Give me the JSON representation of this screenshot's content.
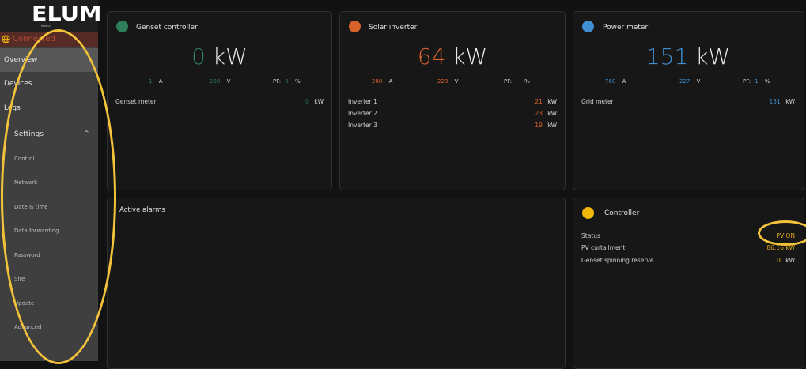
{
  "brand": {
    "logo": "ELUM",
    "tagline": "ENERGY"
  },
  "connection": {
    "label": "Connected"
  },
  "nav": {
    "overview": "Overview",
    "devices": "Devices",
    "logs": "Logs",
    "settings": "Settings",
    "settings_chevron": "^"
  },
  "settings_sub": {
    "control": "Control",
    "network": "Network",
    "datetime": "Date & time",
    "forwarding": "Data forwarding",
    "password": "Password",
    "site": "Site",
    "update": "Update",
    "advanced": "Advanced"
  },
  "genset": {
    "title": "Genset controller",
    "power": "0",
    "power_unit": "kW",
    "current": "1",
    "current_unit": "A",
    "voltage": "228",
    "voltage_unit": "V",
    "pf_label": "PF:",
    "pf": "0",
    "pf_unit": "%",
    "meter_label": "Genset meter",
    "meter_value": "0",
    "meter_unit": "kW",
    "accent": "#2e7d5b"
  },
  "solar": {
    "title": "Solar inverter",
    "power": "64",
    "power_unit": "kW",
    "current": "280",
    "current_unit": "A",
    "voltage": "228",
    "voltage_unit": "V",
    "pf_label": "PF:",
    "pf": "-",
    "pf_unit": "%",
    "inverters": [
      {
        "label": "Inverter 1",
        "value": "21",
        "unit": "kW"
      },
      {
        "label": "Inverter 2",
        "value": "23",
        "unit": "kW"
      },
      {
        "label": "Inverter 3",
        "value": "19",
        "unit": "kW"
      }
    ],
    "accent": "#d9622b"
  },
  "power_meter": {
    "title": "Power meter",
    "power": "151",
    "power_unit": "kW",
    "current": "760",
    "current_unit": "A",
    "voltage": "227",
    "voltage_unit": "V",
    "pf_label": "PF:",
    "pf": "1",
    "pf_unit": "%",
    "meter_label": "Grid meter",
    "meter_value": "151",
    "meter_unit": "kW",
    "accent": "#3f8fd2"
  },
  "alarms": {
    "title": "Active alarms"
  },
  "controller": {
    "title": "Controller",
    "status_label": "Status",
    "status_value": "PV ON",
    "curtail_label": "PV curtailment",
    "curtail_value": "86.16 kW",
    "reserve_label": "Genset spinning reserve",
    "reserve_value": "0",
    "reserve_unit": "kW",
    "accent": "#f2b90c"
  },
  "colors": {
    "highlight": "#f2c33a",
    "orange": "#d9622b",
    "blue": "#3f8fd2",
    "green": "#2e7d5b",
    "yellow": "#e0a91a"
  }
}
